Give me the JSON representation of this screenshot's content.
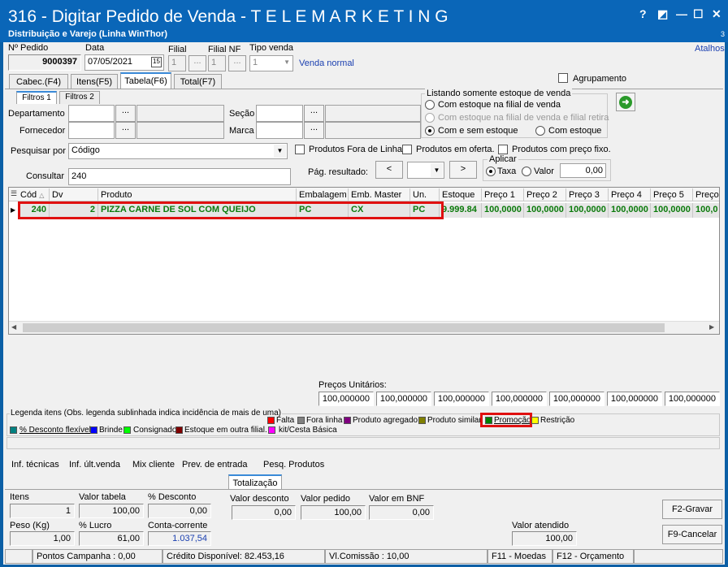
{
  "window": {
    "title": "316 - Digitar Pedido de Venda - T E L E M A R K E T I N G",
    "subtitle": "Distribuição e Varejo (Linha WinThor)",
    "help": "?",
    "restore": "◩",
    "minimize": "—",
    "maximize": "☐",
    "close": "✕",
    "corner_num": "3"
  },
  "header": {
    "pedido_label": "Nº Pedido",
    "pedido_value": "9000397",
    "data_label": "Data",
    "data_value": "07/05/2021",
    "filial_label": "Filial",
    "filial_value": "1",
    "filialnf_label": "Filial NF",
    "filialnf_value": "1",
    "tipo_label": "Tipo venda",
    "tipo_value": "1",
    "tipo_desc": "Venda normal",
    "atalhos": "Atalhos",
    "dots": "..."
  },
  "tabs": [
    "Cabec.(F4)",
    "Itens(F5)",
    "Tabela(F6)",
    "Total(F7)"
  ],
  "subtabs": [
    "Filtros 1",
    "Filtros 2"
  ],
  "agrupamento": "Agrupamento",
  "filters": {
    "departamento": "Departamento",
    "secao": "Seção",
    "fornecedor": "Fornecedor",
    "marca": "Marca",
    "pesquisar_label": "Pesquisar por",
    "pesquisar_value": "Código",
    "consultar_label": "Consultar",
    "consultar_value": "240",
    "fora_linha": "Produtos Fora de Linha",
    "em_oferta": "Produtos em oferta.",
    "preco_fixo": "Produtos com preço fixo.",
    "pag_label": "Pág. resultado:",
    "prev": "<",
    "next": ">"
  },
  "estoque": {
    "title": "Listando somente estoque de venda",
    "opt1": "Com estoque na filial de venda",
    "opt2": "Com estoque na filial de venda e filial retira",
    "opt3": "Com e sem estoque",
    "opt4": "Com estoque"
  },
  "aplicar": {
    "title": "Aplicar",
    "taxa": "Taxa",
    "valor": "Valor",
    "value": "0,00"
  },
  "grid": {
    "columns": [
      "Cód",
      "Dv",
      "Produto",
      "Embalagem",
      "Emb. Master",
      "Un.",
      "Estoque",
      "Preço 1",
      "Preço 2",
      "Preço 3",
      "Preço 4",
      "Preço 5",
      "Preço"
    ],
    "row": [
      "240",
      "2",
      "PIZZA CARNE DE SOL COM QUEIJO",
      "PC",
      "CX",
      "PC",
      "9.999.84",
      "100,0000",
      "100,0000",
      "100,0000",
      "100,0000",
      "100,0000",
      "100,0"
    ]
  },
  "precos": {
    "label": "Preços Unitários:",
    "values": [
      "100,000000",
      "100,000000",
      "100,000000",
      "100,000000",
      "100,000000",
      "100,000000",
      "100,000000"
    ]
  },
  "legend": {
    "title": "Legenda itens (Obs. legenda sublinhada indica incidência de mais de uma)",
    "items": [
      {
        "label": "Falta",
        "color": "#ff0000"
      },
      {
        "label": "Fora linha",
        "color": "#808080"
      },
      {
        "label": "Produto agregado.",
        "color": "#800080"
      },
      {
        "label": "Produto similar",
        "color": "#808000"
      },
      {
        "label": "Promoção",
        "color": "#008000"
      },
      {
        "label": "Restrição",
        "color": "#ffff00"
      },
      {
        "label": "% Desconto flexível",
        "color": "#008080"
      },
      {
        "label": "Brinde",
        "color": "#0000ff"
      },
      {
        "label": "Consignado",
        "color": "#00ff00"
      },
      {
        "label": "Estoque em outra filial.",
        "color": "#800000"
      },
      {
        "label": "kit/Cesta Básica",
        "color": "#ff00ff"
      }
    ]
  },
  "links": [
    "Inf. técnicas",
    "Inf. últ.venda",
    "Mix cliente",
    "Prev. de entrada",
    "Pesq. Produtos"
  ],
  "totalizacao": {
    "tab": "Totalização",
    "itens_label": "Itens",
    "itens": "1",
    "vt_label": "Valor tabela",
    "vt": "100,00",
    "desc_label": "% Desconto",
    "desc": "0,00",
    "peso_label": "Peso (Kg)",
    "peso": "1,00",
    "lucro_label": "% Lucro",
    "lucro": "61,00",
    "cc_label": "Conta-corrente",
    "cc": "1.037,54",
    "vdesc_label": "Valor desconto",
    "vdesc": "0,00",
    "vped_label": "Valor pedido",
    "vped": "100,00",
    "vbnf_label": "Valor em BNF",
    "vbnf": "0,00",
    "vat_label": "Valor atendido",
    "vat": "100,00",
    "gravar": "F2-Gravar",
    "cancelar": "F9-Cancelar"
  },
  "status": {
    "pontos": "Pontos Campanha : 0,00",
    "credito": "Crédito Disponível: 82.453,16",
    "comissao": "Vl.Comissão : 10,00",
    "moedas": "F11 - Moedas",
    "orcamento": "F12 - Orçamento"
  }
}
